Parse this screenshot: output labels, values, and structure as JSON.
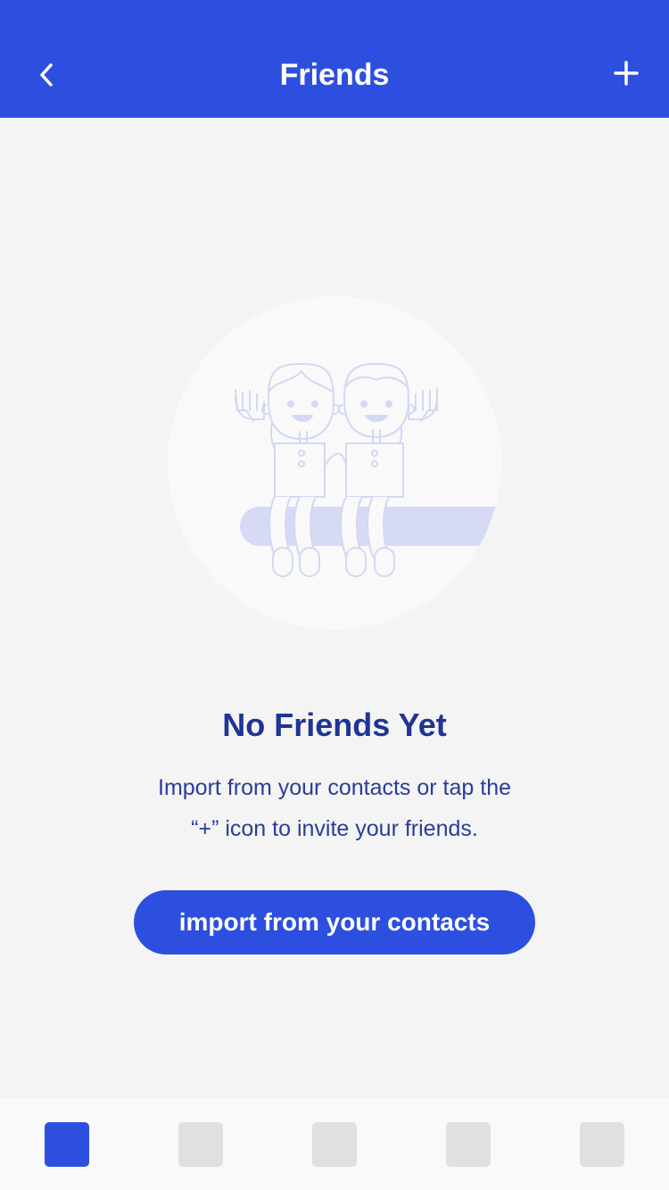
{
  "header": {
    "title": "Friends",
    "back_icon": "chevron-left-icon",
    "add_icon": "plus-icon"
  },
  "empty_state": {
    "illustration": "two-friends-sitting-illustration",
    "title": "No Friends Yet",
    "description_lines": [
      "Import from your contacts or tap the",
      "“+” icon to invite your friends."
    ],
    "button_label": "import from your contacts"
  },
  "tabbar": {
    "tabs": [
      {
        "active": true
      },
      {
        "active": false
      },
      {
        "active": false
      },
      {
        "active": false
      },
      {
        "active": false
      }
    ]
  },
  "colors": {
    "accent": "#2d4fe0",
    "title_text": "#1f3494",
    "background": "#f4f4f4",
    "tab_inactive": "#e0e0e0"
  }
}
